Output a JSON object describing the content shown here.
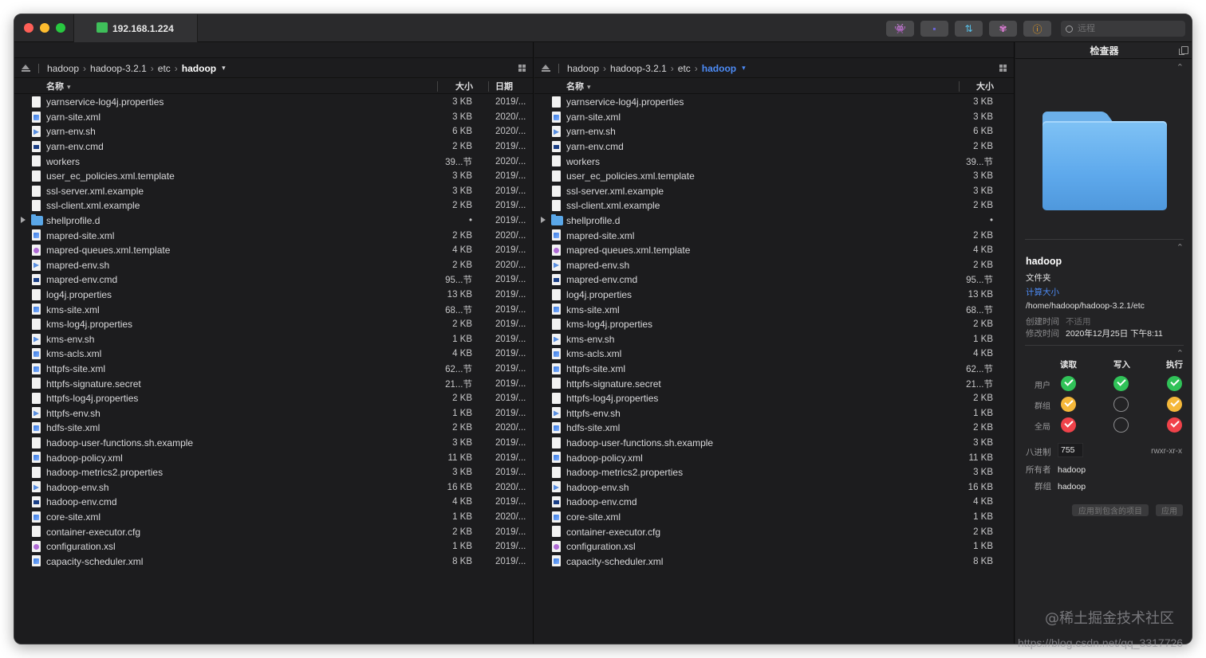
{
  "titlebar": {
    "tab_label": "192.168.1.224",
    "buttons": [
      {
        "name": "ghost-button",
        "glyph": "👾",
        "color": "#c8a8ff"
      },
      {
        "name": "terminal-button",
        "glyph": "▪",
        "color": "#6a63d6"
      },
      {
        "name": "transfer-button",
        "glyph": "⇅",
        "color": "#57c0e8"
      },
      {
        "name": "sync-button",
        "glyph": "✾",
        "color": "#e07ed8"
      },
      {
        "name": "info-button",
        "glyph": "ⓘ",
        "color": "#f0a020"
      }
    ],
    "search_placeholder": "远程"
  },
  "left_pane": {
    "breadcrumb": [
      "hadoop",
      "hadoop-3.2.1",
      "etc",
      "hadoop"
    ],
    "col_name": "名称",
    "col_size": "大小",
    "col_date": "日期"
  },
  "right_pane": {
    "breadcrumb": [
      "hadoop",
      "hadoop-3.2.1",
      "etc",
      "hadoop"
    ],
    "col_name": "名称",
    "col_size": "大小"
  },
  "files": [
    {
      "name": "yarnservice-log4j.properties",
      "size": "3 KB",
      "date": "2019/...",
      "icon": "doc"
    },
    {
      "name": "yarn-site.xml",
      "size": "3 KB",
      "date": "2020/...",
      "icon": "xml"
    },
    {
      "name": "yarn-env.sh",
      "size": "6 KB",
      "date": "2020/...",
      "icon": "sh"
    },
    {
      "name": "yarn-env.cmd",
      "size": "2 KB",
      "date": "2019/...",
      "icon": "cmd"
    },
    {
      "name": "workers",
      "size": "39...节",
      "date": "2020/...",
      "icon": "doc"
    },
    {
      "name": "user_ec_policies.xml.template",
      "size": "3 KB",
      "date": "2019/...",
      "icon": "doc"
    },
    {
      "name": "ssl-server.xml.example",
      "size": "3 KB",
      "date": "2019/...",
      "icon": "doc"
    },
    {
      "name": "ssl-client.xml.example",
      "size": "2 KB",
      "date": "2019/...",
      "icon": "doc"
    },
    {
      "name": "shellprofile.d",
      "size": "•",
      "date": "2019/...",
      "icon": "folder"
    },
    {
      "name": "mapred-site.xml",
      "size": "2 KB",
      "date": "2020/...",
      "icon": "xml"
    },
    {
      "name": "mapred-queues.xml.template",
      "size": "4 KB",
      "date": "2019/...",
      "icon": "xsl"
    },
    {
      "name": "mapred-env.sh",
      "size": "2 KB",
      "date": "2020/...",
      "icon": "sh"
    },
    {
      "name": "mapred-env.cmd",
      "size": "95...节",
      "date": "2019/...",
      "icon": "cmd"
    },
    {
      "name": "log4j.properties",
      "size": "13 KB",
      "date": "2019/...",
      "icon": "doc"
    },
    {
      "name": "kms-site.xml",
      "size": "68...节",
      "date": "2019/...",
      "icon": "xml"
    },
    {
      "name": "kms-log4j.properties",
      "size": "2 KB",
      "date": "2019/...",
      "icon": "doc"
    },
    {
      "name": "kms-env.sh",
      "size": "1 KB",
      "date": "2019/...",
      "icon": "sh"
    },
    {
      "name": "kms-acls.xml",
      "size": "4 KB",
      "date": "2019/...",
      "icon": "xml"
    },
    {
      "name": "httpfs-site.xml",
      "size": "62...节",
      "date": "2019/...",
      "icon": "xml"
    },
    {
      "name": "httpfs-signature.secret",
      "size": "21...节",
      "date": "2019/...",
      "icon": "doc"
    },
    {
      "name": "httpfs-log4j.properties",
      "size": "2 KB",
      "date": "2019/...",
      "icon": "doc"
    },
    {
      "name": "httpfs-env.sh",
      "size": "1 KB",
      "date": "2019/...",
      "icon": "sh"
    },
    {
      "name": "hdfs-site.xml",
      "size": "2 KB",
      "date": "2020/...",
      "icon": "xml"
    },
    {
      "name": "hadoop-user-functions.sh.example",
      "size": "3 KB",
      "date": "2019/...",
      "icon": "doc"
    },
    {
      "name": "hadoop-policy.xml",
      "size": "11 KB",
      "date": "2019/...",
      "icon": "xml"
    },
    {
      "name": "hadoop-metrics2.properties",
      "size": "3 KB",
      "date": "2019/...",
      "icon": "doc"
    },
    {
      "name": "hadoop-env.sh",
      "size": "16 KB",
      "date": "2020/...",
      "icon": "sh"
    },
    {
      "name": "hadoop-env.cmd",
      "size": "4 KB",
      "date": "2019/...",
      "icon": "cmd"
    },
    {
      "name": "core-site.xml",
      "size": "1 KB",
      "date": "2020/...",
      "icon": "xml"
    },
    {
      "name": "container-executor.cfg",
      "size": "2 KB",
      "date": "2019/...",
      "icon": "doc"
    },
    {
      "name": "configuration.xsl",
      "size": "1 KB",
      "date": "2019/...",
      "icon": "xsl"
    },
    {
      "name": "capacity-scheduler.xml",
      "size": "8 KB",
      "date": "2019/...",
      "icon": "xml"
    }
  ],
  "inspector": {
    "title": "检查器",
    "name": "hadoop",
    "kind": "文件夹",
    "calc_size": "计算大小",
    "path": "/home/hadoop/hadoop-3.2.1/etc",
    "created_label": "创建时间",
    "created_value": "不适用",
    "modified_label": "修改时间",
    "modified_value": "2020年12月25日 下午8:11",
    "perm_headers": [
      "读取",
      "写入",
      "执行"
    ],
    "perm_rows": [
      {
        "label": "用户",
        "cells": [
          "green",
          "green",
          "green"
        ]
      },
      {
        "label": "群组",
        "cells": [
          "yellow",
          "empty",
          "yellow"
        ]
      },
      {
        "label": "全局",
        "cells": [
          "red",
          "empty",
          "red"
        ]
      }
    ],
    "octal_label": "八进制",
    "octal_value": "755",
    "rwx": "rwxr-xr-x",
    "owner_label": "所有者",
    "owner_value": "hadoop",
    "group_label": "群组",
    "group_value": "hadoop",
    "apply_included": "应用到包含的项目",
    "apply": "应用"
  },
  "watermark": "@稀土掘金技术社区",
  "watermark_url": "https://blog.csdn.net/qq_3317726"
}
